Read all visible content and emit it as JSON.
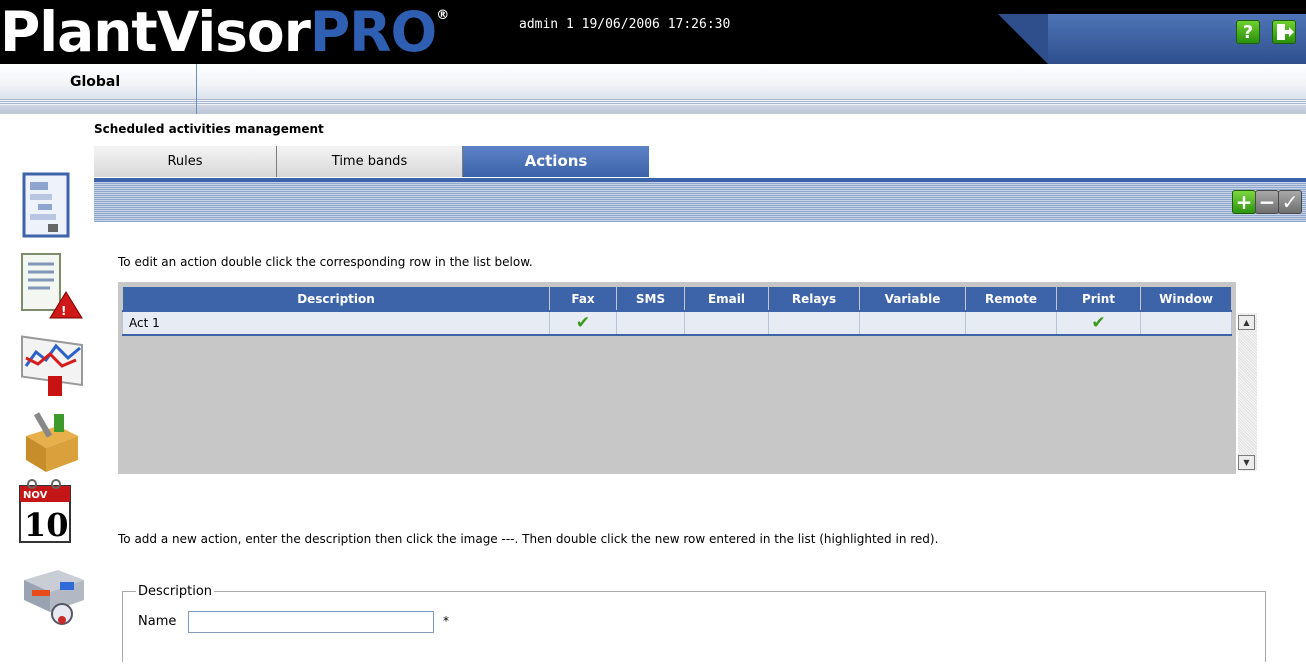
{
  "header": {
    "logo": "PlantVisorPRO",
    "logo_plant": "PlantVisor",
    "logo_pro": "PRO",
    "logo_reg": "®",
    "user_info": "admin 1 19/06/2006 17:26:30",
    "help_icon": "?",
    "logout_icon": "exit-door-icon"
  },
  "global_bar": {
    "label": "Global"
  },
  "sidebar": {
    "icons": [
      "scheduler-icon",
      "alarm-report-icon",
      "graph-icon",
      "maintenance-toolbox-icon",
      "calendar-icon",
      "devices-config-icon"
    ],
    "calendar_month": "NOV",
    "calendar_day": "10"
  },
  "page": {
    "title": "Scheduled activities management"
  },
  "tabs": [
    {
      "label": "Rules",
      "active": false
    },
    {
      "label": "Time bands",
      "active": false
    },
    {
      "label": "Actions",
      "active": true
    }
  ],
  "toolbar": {
    "add": "+",
    "remove": "−",
    "confirm": "✓"
  },
  "instructions": {
    "edit": "To edit an action double click the corresponding row in the list below.",
    "add": "To add a new action, enter the description then click the image ---. Then double click the new row entered in the list (highlighted in red)."
  },
  "table": {
    "columns": [
      "Description",
      "Fax",
      "SMS",
      "Email",
      "Relays",
      "Variable",
      "Remote",
      "Print",
      "Window"
    ],
    "rows": [
      {
        "description": "Act 1",
        "fax": true,
        "sms": false,
        "email": false,
        "relays": false,
        "variable": false,
        "remote": false,
        "print": true,
        "window": false
      }
    ],
    "check_glyph": "✔"
  },
  "form": {
    "legend": "Description",
    "name_label": "Name",
    "name_value": "",
    "required_mark": "*"
  },
  "colors": {
    "accent_blue": "#3d63a9",
    "header_bg": "#000000",
    "check_green": "#3a9a1a"
  }
}
